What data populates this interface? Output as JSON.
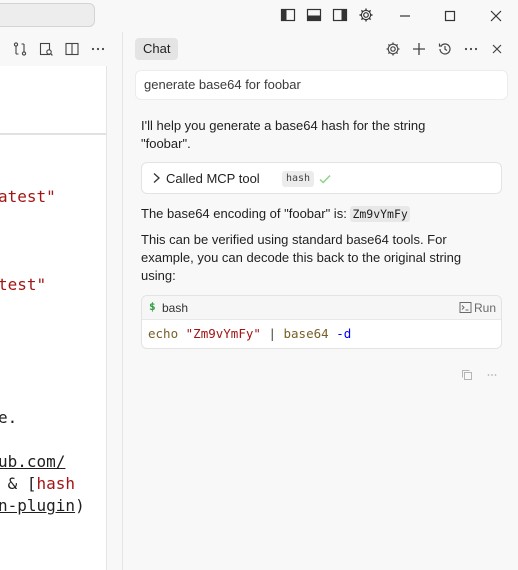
{
  "chat": {
    "tab_label": "Chat",
    "prompt": "generate base64 for foobar",
    "intro_line1": "I'll help you generate a base64 hash for the string",
    "intro_line2": "\"foobar\".",
    "tool_call": {
      "label": "Called MCP tool",
      "tool_name": "hash"
    },
    "result_prefix": "The base64 encoding of \"foobar\" is:",
    "result_value": "Zm9vYmFy",
    "verify_line1": "This can be verified using standard base64 tools. For",
    "verify_line2": "example, you can decode this back to the original string",
    "verify_line3": "using:",
    "code_block": {
      "language": "bash",
      "run_label": "Run",
      "tokens": {
        "cmd": "echo",
        "arg": "\"Zm9vYmFy\"",
        "pipe": "|",
        "prog": "base64",
        "flag": "-d"
      }
    }
  },
  "editor": {
    "lines": [
      {
        "text": "atest\""
      },
      {
        "text": "test\""
      },
      {
        "text": "e."
      },
      {
        "text": "ub.com/"
      },
      {
        "pre": " & [",
        "red": "hash"
      },
      {
        "u": "n-plugin",
        "post": ")"
      }
    ]
  },
  "colors": {
    "accent": "#a31515",
    "check": "#89d185",
    "panel_bg": "#f8f8f8"
  }
}
